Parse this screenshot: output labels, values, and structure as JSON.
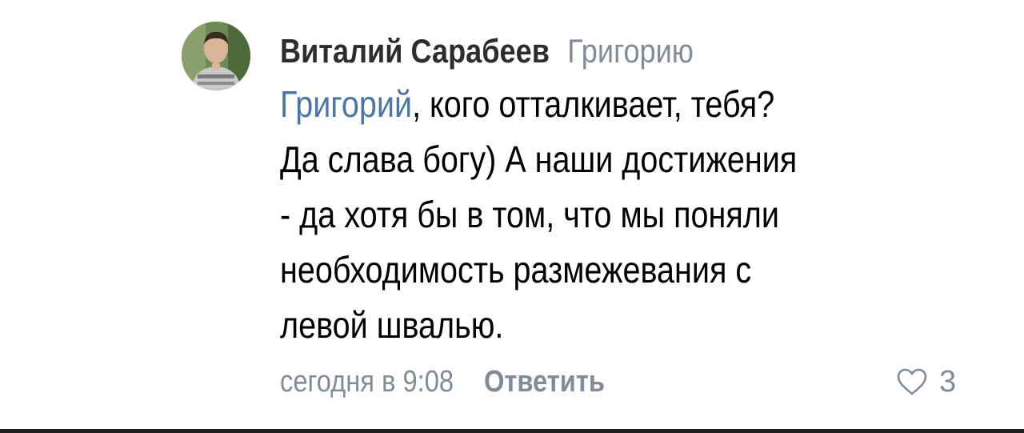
{
  "comment": {
    "author": "Виталий Сарабеев",
    "reply_to": "Григорию",
    "mention": "Григорий",
    "text_lines": [
      ", кого отталкивает, тебя?",
      "Да слава богу) А наши достижения",
      "- да хотя бы в том, что мы поняли",
      "необходимость размежевания с",
      "левой швалью."
    ],
    "timestamp": "сегодня в 9:08",
    "reply_label": "Ответить",
    "like_count": "3",
    "icons": {
      "avatar": "user-photo",
      "like": "heart-outline-icon"
    },
    "colors": {
      "author": "#2c2d2e",
      "secondary": "#818c99",
      "mention": "#4a76a8"
    }
  }
}
